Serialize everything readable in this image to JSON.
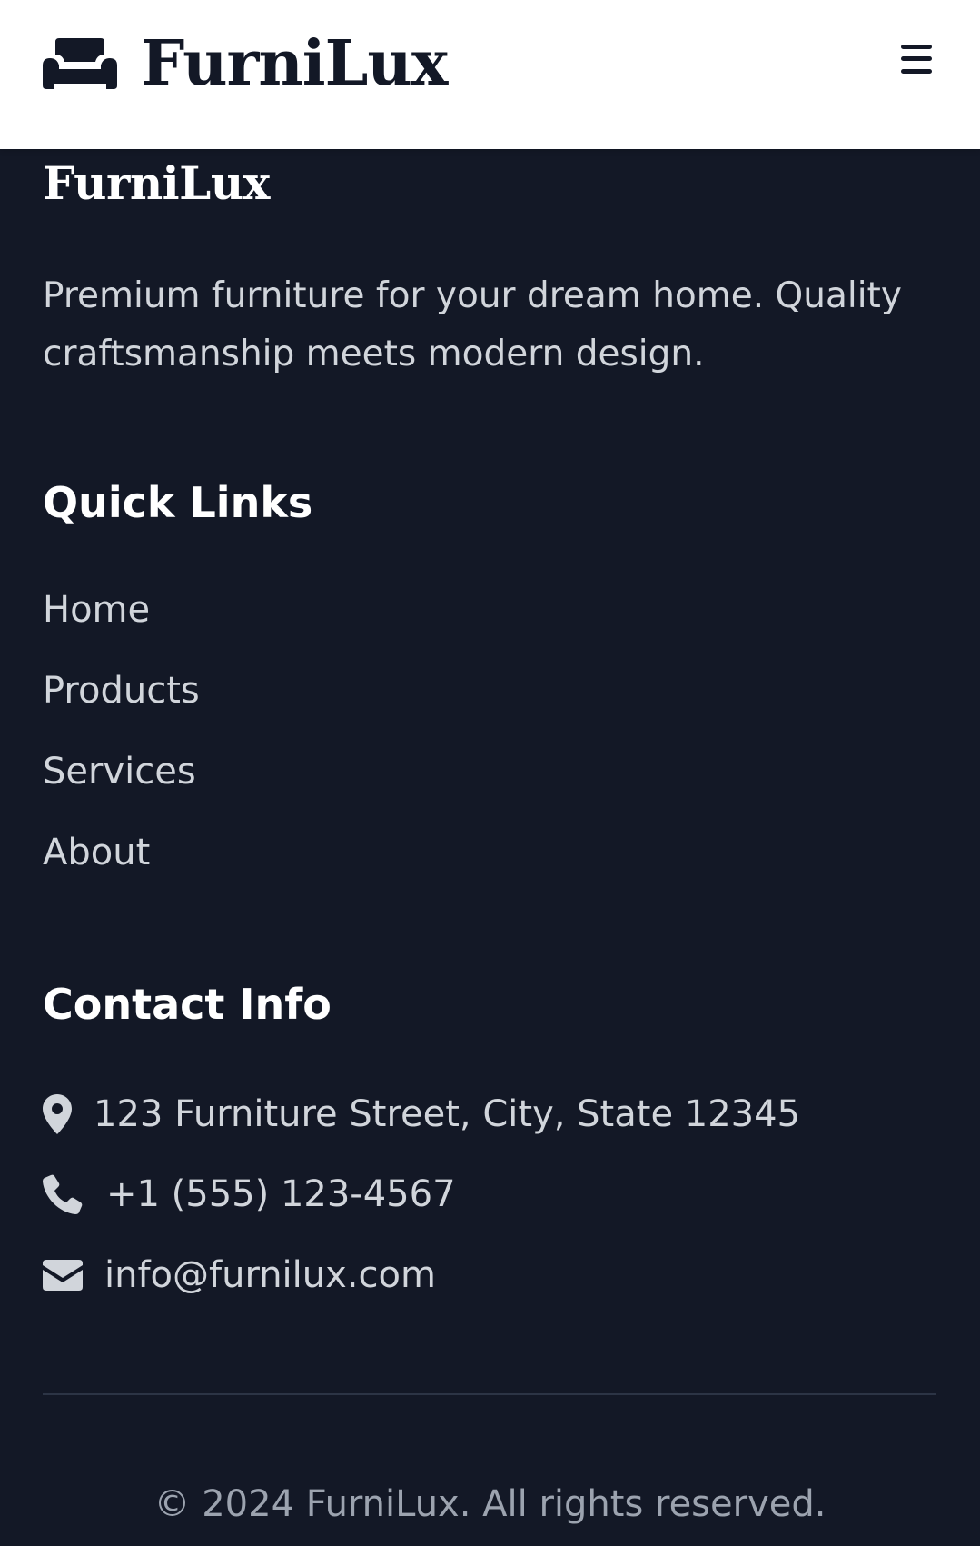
{
  "header": {
    "logo_text": "FurniLux",
    "logo_icon": "couch-icon",
    "menu_icon": "hamburger-menu-icon"
  },
  "footer": {
    "brand": "FurniLux",
    "tagline": "Premium furniture for your dream home. Quality craftsmanship meets modern design.",
    "quick_links": {
      "title": "Quick Links",
      "items": [
        "Home",
        "Products",
        "Services",
        "About"
      ]
    },
    "contact": {
      "title": "Contact Info",
      "address": "123 Furniture Street, City, State 12345",
      "phone": "+1 (555) 123-4567",
      "email": "info@furnilux.com"
    },
    "copyright": "© 2024 FurniLux. All rights reserved."
  },
  "colors": {
    "header_bg": "#ffffff",
    "footer_bg": "#131826",
    "text_light": "#d1d5db",
    "heading": "#ffffff",
    "muted": "#9ca3af"
  }
}
